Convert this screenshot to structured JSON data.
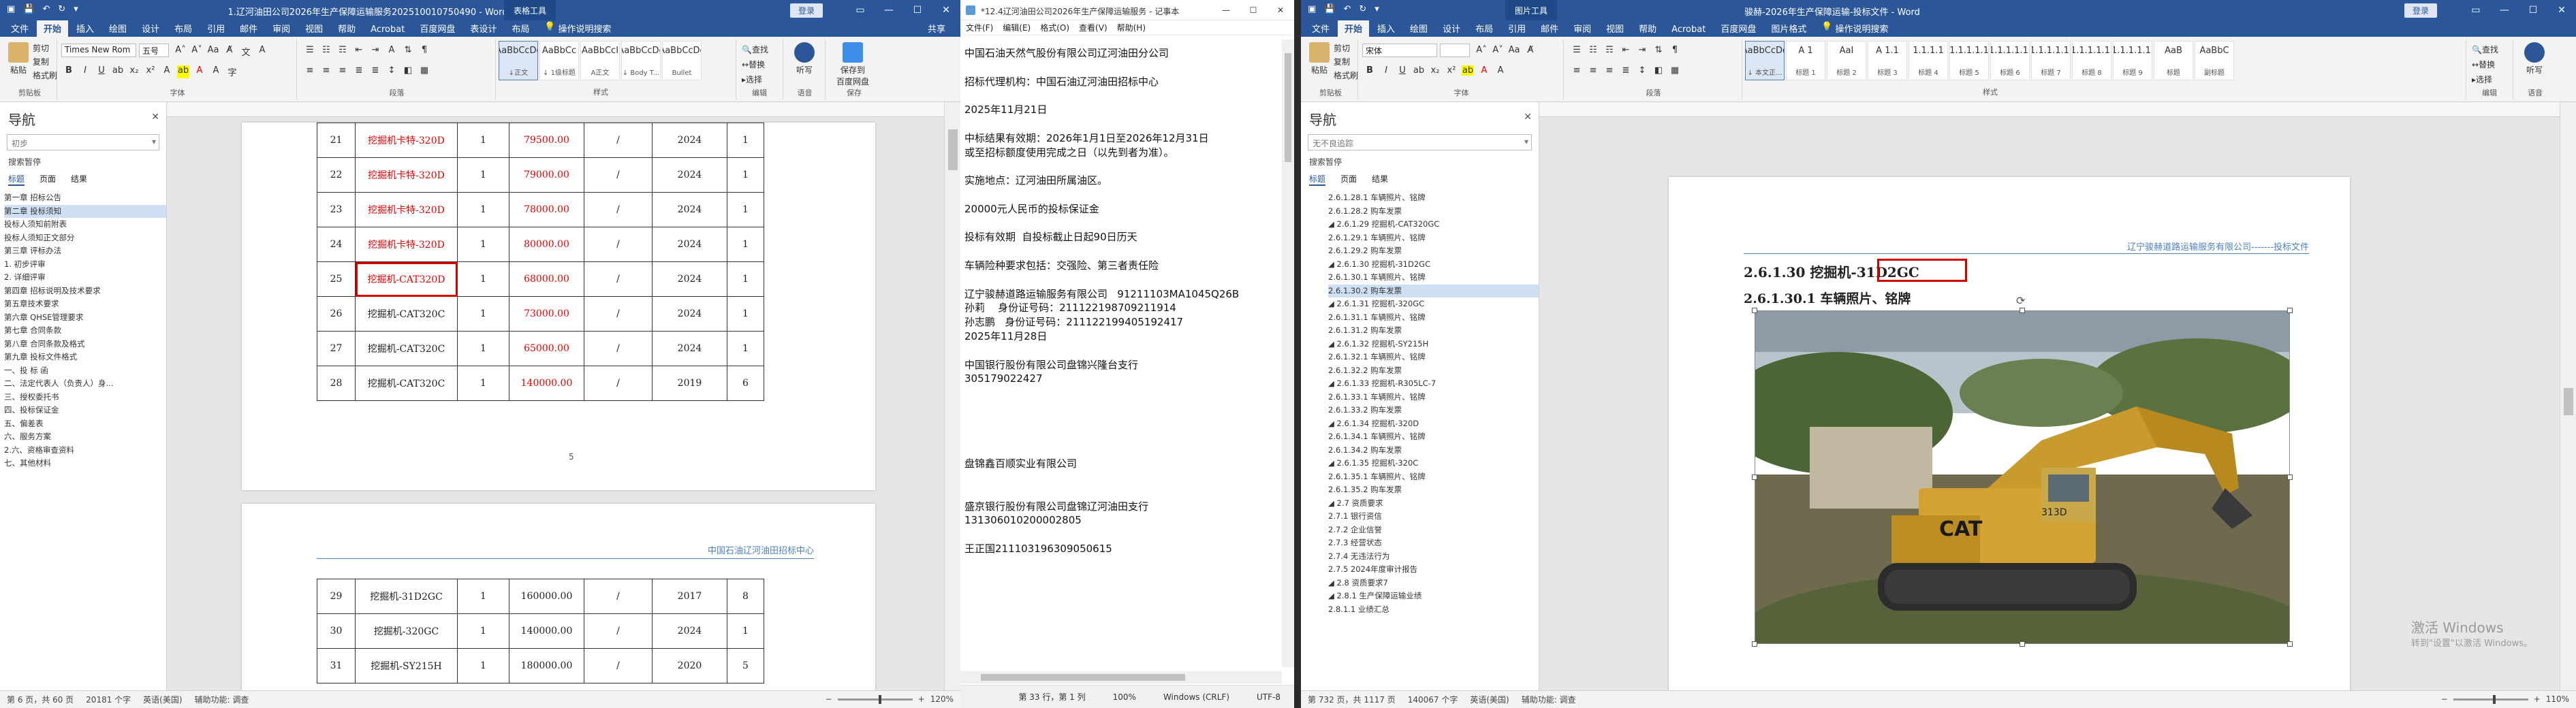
{
  "left_word": {
    "title": "1.辽河油田公司2026年生产保障运输服务202510010750490 - Word",
    "context_tab": "表格工具",
    "login": "登录",
    "tabs": [
      "文件",
      "开始",
      "插入",
      "绘图",
      "设计",
      "布局",
      "引用",
      "邮件",
      "审阅",
      "视图",
      "帮助",
      "Acrobat",
      "百度网盘",
      "表设计",
      "布局"
    ],
    "tell_me": "操作说明搜索",
    "share": "共享",
    "font_name": "Times New Rom",
    "font_size": "五号",
    "clipboard": {
      "paste": "粘贴",
      "cut": "剪切",
      "copy": "复制",
      "painter": "格式刷",
      "label": "剪贴板"
    },
    "group_labels": {
      "font": "字体",
      "paragraph": "段落",
      "styles": "样式",
      "editing": "编辑",
      "voice": "语音",
      "save": "保存"
    },
    "styles": [
      {
        "preview": "AaBbCcDc",
        "name": "↓正文"
      },
      {
        "preview": "AaBbCc",
        "name": "↓ 1级标题"
      },
      {
        "preview": "AaBbCcI",
        "name": "A正文"
      },
      {
        "preview": "AaBbCcDc",
        "name": "↓ Body T..."
      },
      {
        "preview": "AaBbCcDc",
        "name": "Bullet"
      }
    ],
    "editing": {
      "find": "查找",
      "replace": "替换",
      "select": "选择"
    },
    "dictation": "听写",
    "save_baidu": "保存到\n百度网盘",
    "nav": {
      "title": "导航",
      "search": "初步",
      "results": "搜索暂停",
      "tabs": [
        "标题",
        "页面",
        "结果"
      ],
      "tree": [
        "第一章 招标公告",
        "第二章 投标须知",
        "投标人须知前附表",
        "投标人须知正文部分",
        "第三章 评标办法",
        "1. 初步评审",
        "2. 详细评审",
        "第四章 招标说明及技术要求",
        "第五章技术要求",
        "第六章 QHSE管理要求",
        "第七章 合同条款",
        "第八章 合同条款及格式",
        "第九章 投标文件格式",
        "一、投 标 函",
        "二、法定代表人（负责人）身...",
        "三、授权委托书",
        "四、投标保证金",
        "五、偏差表",
        "六、服务方案",
        "2.六、资格审查资料",
        "七、其他材料"
      ]
    },
    "table1": [
      [
        "21",
        "挖掘机卡特-320D",
        "1",
        "79500.00",
        "/",
        "2024",
        "1"
      ],
      [
        "22",
        "挖掘机卡特-320D",
        "1",
        "79000.00",
        "/",
        "2024",
        "1"
      ],
      [
        "23",
        "挖掘机卡特-320D",
        "1",
        "78000.00",
        "/",
        "2024",
        "1"
      ],
      [
        "24",
        "挖掘机卡特-320D",
        "1",
        "80000.00",
        "/",
        "2024",
        "1"
      ],
      [
        "25",
        "挖掘机-CAT320D",
        "1",
        "68000.00",
        "/",
        "2024",
        "1"
      ],
      [
        "26",
        "挖掘机-CAT320C",
        "1",
        "73000.00",
        "/",
        "2024",
        "1"
      ],
      [
        "27",
        "挖掘机-CAT320C",
        "1",
        "65000.00",
        "/",
        "2024",
        "1"
      ],
      [
        "28",
        "挖掘机-CAT320C",
        "1",
        "140000.00",
        "/",
        "2019",
        "6"
      ]
    ],
    "page_number": "5",
    "page2_header": "中国石油辽河油田招标中心",
    "table2": [
      [
        "29",
        "挖掘机-31D2GC",
        "1",
        "160000.00",
        "/",
        "2017",
        "8"
      ],
      [
        "30",
        "挖掘机-320GC",
        "1",
        "140000.00",
        "/",
        "2024",
        "1"
      ],
      [
        "31",
        "挖掘机-SY215H",
        "1",
        "180000.00",
        "/",
        "2020",
        "5"
      ]
    ],
    "status": {
      "page": "第 6 页，共 60 页",
      "words": "20181 个字",
      "lang": "英语(美国)",
      "accessibility": "辅助功能: 调查",
      "zoom": "120%"
    }
  },
  "notepad": {
    "title": "*12.4辽河油田公司2026年生产保障运输服务 - 记事本",
    "menu": [
      "文件(F)",
      "编辑(E)",
      "格式(O)",
      "查看(V)",
      "帮助(H)"
    ],
    "text": "中国石油天然气股份有限公司辽河油田分公司\n\n招标代理机构：中国石油辽河油田招标中心\n\n2025年11月21日\n\n中标结果有效期：2026年1月1日至2026年12月31日\n或至招标额度使用完成之日（以先到者为准）。\n\n实施地点：辽河油田所属油区。\n\n20000元人民币的投标保证金\n\n投标有效期  自投标截止日起90日历天\n\n车辆险种要求包括：交强险、第三者责任险\n\n辽宁骏赫道路运输服务有限公司   91211103MA1045Q26B\n孙莉    身份证号码：211122198709211914\n孙志鹏   身份证号码：211122199405192417\n2025年11月28日\n\n中国银行股份有限公司盘锦兴隆台支行\n305179022427\n\n\n\n\n\n盘锦鑫百顺实业有限公司\n\n\n盛京银行股份有限公司盘锦辽河油田支行\n131306010200002805\n\n王正国211103196309050615",
    "status": {
      "pos": "第 33 行，第 1 列",
      "zoom": "100%",
      "eol": "Windows (CRLF)",
      "enc": "UTF-8"
    }
  },
  "right_word": {
    "title": "骏赫-2026年生产保障运输-投标文件 - Word",
    "context_tab": "图片工具",
    "login": "登录",
    "tabs": [
      "文件",
      "开始",
      "插入",
      "绘图",
      "设计",
      "布局",
      "引用",
      "邮件",
      "审阅",
      "视图",
      "帮助",
      "Acrobat",
      "百度网盘",
      "图片格式"
    ],
    "tell_me": "操作说明搜索",
    "font_name": "宋体",
    "styles": [
      {
        "preview": "AaBbCcDd",
        "name": "↓ 本文正..."
      },
      {
        "preview": "A 1",
        "name": "标题 1"
      },
      {
        "preview": "AaI",
        "name": "标题 2"
      },
      {
        "preview": "A 1.1",
        "name": "标题 3"
      },
      {
        "preview": "1.1.1.1",
        "name": "标题 4"
      },
      {
        "preview": "1.1.1.1.1",
        "name": "标题 5"
      },
      {
        "preview": "1.1.1.1.1.",
        "name": "标题 6"
      },
      {
        "preview": "1.1.1.1.1.",
        "name": "标题 7"
      },
      {
        "preview": "1.1.1.1.1.",
        "name": "标题 8"
      },
      {
        "preview": "1.1.1.1.1.",
        "name": "标题 9"
      },
      {
        "preview": "AaB",
        "name": "标题"
      },
      {
        "preview": "AaBbC",
        "name": "副标题"
      }
    ],
    "nav": {
      "title": "导航",
      "search": "无不良追踪",
      "results": "搜索暂停",
      "tabs": [
        "标题",
        "页面",
        "结果"
      ],
      "tree": [
        "2.6.1.28.1 车辆照片、铭牌",
        "2.6.1.28.2 购车发票",
        "◢ 2.6.1.29 挖掘机-CAT320GC",
        "2.6.1.29.1 车辆照片、铭牌",
        "2.6.1.29.2 购车发票",
        "◢ 2.6.1.30 挖掘机-31D2GC",
        "2.6.1.30.1 车辆照片、铭牌",
        "2.6.1.30.2 购车发票",
        "◢ 2.6.1.31 挖掘机-320GC",
        "2.6.1.31.1 车辆照片、铭牌",
        "2.6.1.31.2 购车发票",
        "◢ 2.6.1.32 挖掘机-SY215H",
        "2.6.1.32.1 车辆照片、铭牌",
        "2.6.1.32.2 购车发票",
        "◢ 2.6.1.33 挖掘机-R305LC-7",
        "2.6.1.33.1 车辆照片、铭牌",
        "2.6.1.33.2 购车发票",
        "◢ 2.6.1.34 挖掘机-320D",
        "2.6.1.34.1 车辆照片、铭牌",
        "2.6.1.34.2 购车发票",
        "◢ 2.6.1.35 挖掘机-320C",
        "2.6.1.35.1 车辆照片、铭牌",
        "2.6.1.35.2 购车发票",
        "◢ 2.7 资质要求",
        "2.7.1 银行资信",
        "2.7.2 企业信誉",
        "2.7.3 经营状态",
        "2.7.4 无违法行为",
        "2.7.5 2024年度审计报告",
        "◢ 2.8 资质要求7",
        "◢ 2.8.1 生产保障运输业绩",
        "2.8.1.1 业绩汇总"
      ]
    },
    "page_header": "辽宁骏赫道路运输服务有限公司-------投标文件",
    "heading1": "2.6.1.30 挖掘机-31D2GC",
    "heading2": "2.6.1.30.1 车辆照片、铭牌",
    "photo_alt": "CAT 挖掘机照片",
    "machine_text": "CAT",
    "machine_model": "313D",
    "status": {
      "page": "第 732 页，共 1117 页",
      "words": "140067 个字",
      "lang": "英语(美国)",
      "accessibility": "辅助功能: 调查",
      "zoom": "110%"
    },
    "watermark": {
      "line1": "激活 Windows",
      "line2": "转到\"设置\"以激活 Windows。"
    }
  }
}
